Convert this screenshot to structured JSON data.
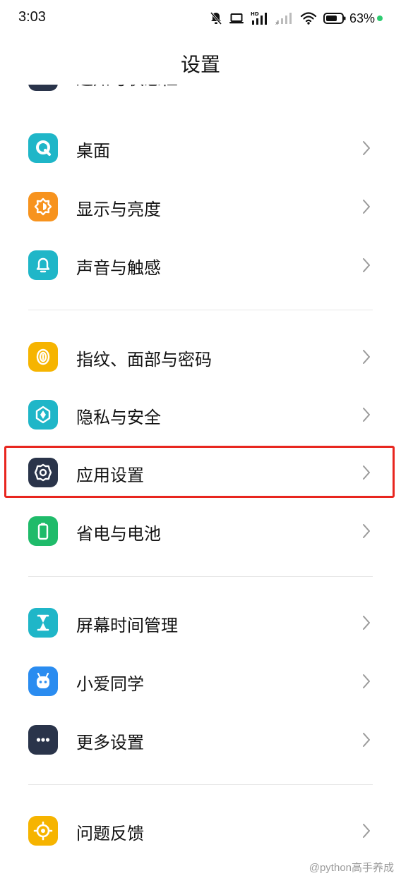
{
  "status_bar": {
    "time": "3:03",
    "battery_percent": "63%",
    "icons": [
      "mute-bell-icon",
      "laptop-icon",
      "hd-signal-icon",
      "signal-icon",
      "wifi-icon",
      "battery-icon"
    ]
  },
  "header": {
    "title": "设置"
  },
  "items": [
    {
      "label": "通知与状态栏",
      "icon": "notification-icon",
      "color": "#2a344a"
    },
    {
      "label": "桌面",
      "icon": "desktop-icon",
      "color": "#1fb6c8"
    },
    {
      "label": "显示与亮度",
      "icon": "brightness-icon",
      "color": "#f7931e"
    },
    {
      "label": "声音与触感",
      "icon": "bell-icon",
      "color": "#1fb6c8"
    },
    {
      "label": "指纹、面部与密码",
      "icon": "fingerprint-icon",
      "color": "#f6b400"
    },
    {
      "label": "隐私与安全",
      "icon": "privacy-icon",
      "color": "#1fb6c8"
    },
    {
      "label": "应用设置",
      "icon": "app-settings-icon",
      "color": "#2a344a"
    },
    {
      "label": "省电与电池",
      "icon": "battery-saver-icon",
      "color": "#1fbb6a"
    },
    {
      "label": "屏幕时间管理",
      "icon": "hourglass-icon",
      "color": "#1fb6c8"
    },
    {
      "label": "小爱同学",
      "icon": "assistant-icon",
      "color": "#2a8cf0"
    },
    {
      "label": "更多设置",
      "icon": "more-icon",
      "color": "#2a344a"
    },
    {
      "label": "问题反馈",
      "icon": "feedback-icon",
      "color": "#f6b400"
    }
  ],
  "highlight_color": "#e8261f",
  "watermark": "@python高手养成"
}
